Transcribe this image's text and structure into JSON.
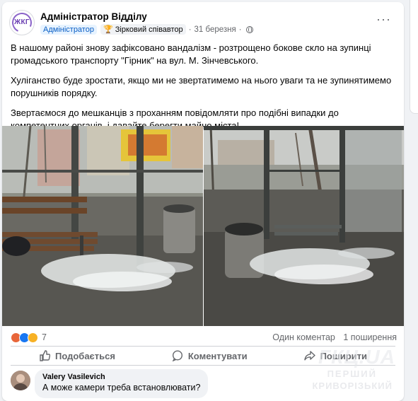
{
  "post": {
    "author": "Адміністратор Відділу",
    "avatar_text": "ЖКГ",
    "badge_admin": "Адміністратор",
    "badge_star": "Зірковий співавтор",
    "date": "31 березня",
    "separator": "·",
    "more_icon": "more-horizontal-icon",
    "paragraphs": [
      "В нашому районі знову зафіксовано вандалізм - розтрощено бокове скло на зупинці громадського транспорту \"Гірник\" на вул. М. Зінчевського.",
      "Хуліганство буде зростати, якщо ми не звертатимемо на нього уваги та не зупинятимемо порушників порядку.",
      "Звертаємося до мешканців з проханням повідомляти про подібні випадки до компетентних органів, і давайте берегти майно міста!"
    ]
  },
  "reactions": {
    "count": "7",
    "comments": "Один коментар",
    "shares": "1 поширення"
  },
  "actions": {
    "like": "Подобається",
    "comment": "Коментувати",
    "share": "Поширити"
  },
  "comment": {
    "name": "Valery Vasilevich",
    "text": "А може камери треба встановлювати?"
  },
  "watermark": {
    "line1": "ГКЦ.UA",
    "line2": "ПЕРШИЙ",
    "line3": "КРИВОРІЗЬКИЙ"
  },
  "colors": {
    "accent": "#1877f2",
    "badge_admin_bg": "#e7f3ff",
    "text_secondary": "#65676b"
  }
}
